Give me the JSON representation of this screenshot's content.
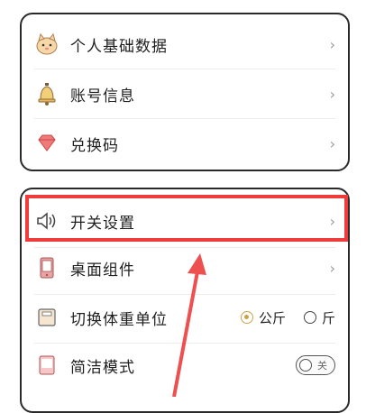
{
  "groups": [
    {
      "items": [
        {
          "label": "个人基础数据",
          "icon": "cat-avatar-icon"
        },
        {
          "label": "账号信息",
          "icon": "bell-icon"
        },
        {
          "label": "兑换码",
          "icon": "gem-icon"
        }
      ]
    },
    {
      "items": [
        {
          "label": "开关设置",
          "icon": "speaker-icon"
        },
        {
          "label": "桌面组件",
          "icon": "phone-widget-icon"
        },
        {
          "label": "切换体重单位",
          "icon": "scale-icon"
        },
        {
          "label": "简洁模式",
          "icon": "simple-mode-icon"
        }
      ]
    }
  ],
  "chevron": "›",
  "weight_unit": {
    "option_kg": "公斤",
    "option_jin": "斤",
    "selected": "公斤"
  },
  "simple_mode": {
    "toggle_text": "关",
    "on": false
  },
  "colors": {
    "highlight": "#ee3b3b",
    "accent": "#c9a349"
  }
}
